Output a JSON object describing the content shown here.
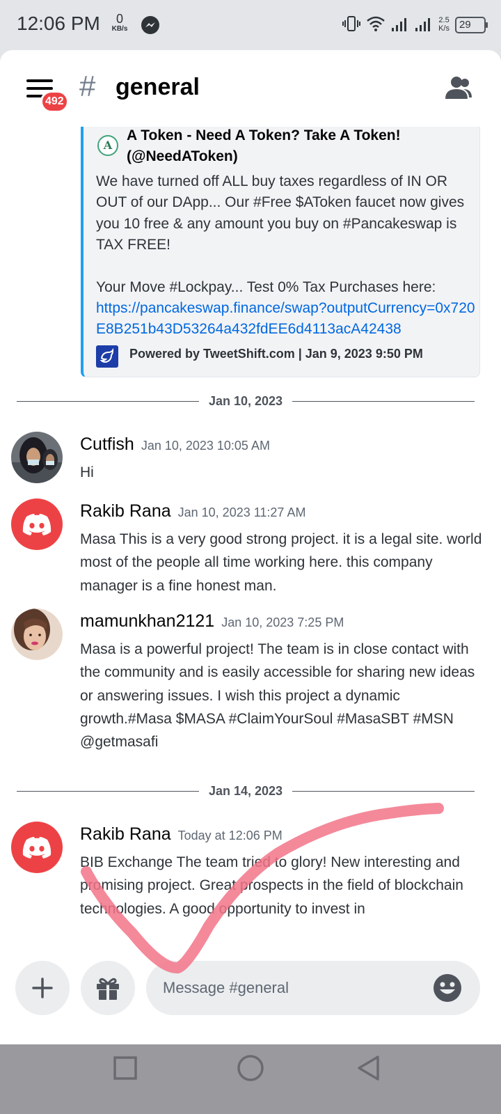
{
  "status_bar": {
    "time": "12:06 PM",
    "kbs_value": "0",
    "kbs_unit": "KB/s",
    "net_speed_value": "2.5",
    "net_speed_unit": "K/s",
    "battery": "29"
  },
  "header": {
    "hamburger_badge": "492",
    "hash": "#",
    "channel_name": "general"
  },
  "embed": {
    "author": "A Token - Need A Token? Take A Token! (@NeedAToken)",
    "description_1": "We have turned off ALL buy taxes regardless of IN OR OUT of our DApp... Our #Free $AToken faucet now gives you 10 free & any amount you buy on #Pancakeswap is TAX FREE!",
    "description_2": "Your Move #Lockpay... Test 0% Tax Purchases here:",
    "link": "https://pancakeswap.finance/swap?outputCurrency=0x720E8B251b43D53264a432fdEE6d4113acA42438",
    "footer": "Powered by TweetShift.com | Jan 9, 2023 9:50 PM",
    "color": "#1da1f2"
  },
  "dividers": [
    "Jan 10, 2023",
    "Jan 14, 2023"
  ],
  "messages": [
    {
      "author": "Cutfish",
      "timestamp": "Jan 10, 2023 10:05 AM",
      "text": "Hi"
    },
    {
      "author": "Rakib Rana",
      "timestamp": "Jan 10, 2023 11:27 AM",
      "text": "Masa This is a very good strong project. it is a legal site. world most of the people all time working here. this company manager is a fine honest man."
    },
    {
      "author": "mamunkhan2121",
      "timestamp": "Jan 10, 2023 7:25 PM",
      "text": "Masa is a powerful project! The team is in close contact with the community and is easily accessible for sharing new ideas or answering issues. I wish this project a dynamic growth.#Masa $MASA #ClaimYourSoul #MasaSBT #MSN\n@getmasafi"
    },
    {
      "author": "Rakib Rana",
      "timestamp": "Today at 12:06 PM",
      "text": "BIB Exchange The team tried to glory! New interesting and promising project. Great prospects in the field of blockchain technologies. A good opportunity to invest in"
    }
  ],
  "composer": {
    "placeholder": "Message #general"
  },
  "colors": {
    "accent_red": "#ed4245",
    "link_blue": "#0068e0",
    "checkmark_pink": "#f27488"
  }
}
